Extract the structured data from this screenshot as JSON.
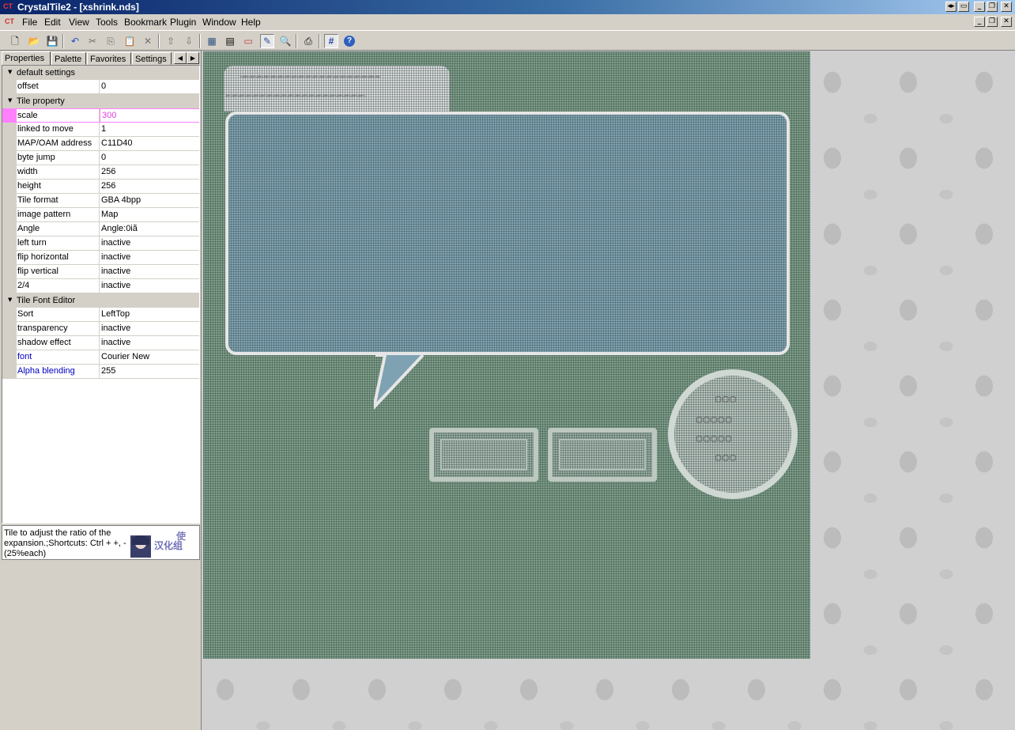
{
  "window": {
    "title": "CrystalTile2 - [xshrink.nds]",
    "app_icon": "crystaltile-logo-icon",
    "app_icon_text": "CT",
    "caption_buttons": [
      "restore-toggle-icon",
      "tile-icon",
      "minimize-icon",
      "maximize-icon",
      "close-icon"
    ],
    "caption_glyphs": [
      "◂▸",
      "▭",
      "_",
      "❐",
      "✕"
    ]
  },
  "menubar": {
    "logo_text": "CT",
    "items": [
      "File",
      "Edit",
      "View",
      "Tools",
      "Bookmark",
      "Plugin",
      "Window",
      "Help"
    ],
    "mdi_glyphs": [
      "_",
      "❐",
      "✕"
    ]
  },
  "toolbar": {
    "buttons": [
      {
        "name": "new-file-icon",
        "glyph": "🗋"
      },
      {
        "name": "open-folder-icon",
        "glyph": "📂"
      },
      {
        "name": "save-icon",
        "glyph": "💾"
      },
      {
        "name": "undo-icon",
        "glyph": "↶"
      },
      {
        "name": "cut-icon",
        "glyph": "✂"
      },
      {
        "name": "copy-icon",
        "glyph": "⎘"
      },
      {
        "name": "paste-icon",
        "glyph": "📋"
      },
      {
        "name": "delete-icon",
        "glyph": "✕"
      },
      {
        "name": "import-icon",
        "glyph": "⇧"
      },
      {
        "name": "export-icon",
        "glyph": "⇩"
      },
      {
        "name": "tile-viewer-icon",
        "glyph": "▦"
      },
      {
        "name": "hex-editor-icon",
        "glyph": "▤"
      },
      {
        "name": "text-icon",
        "glyph": "▭"
      },
      {
        "name": "edit-tile-icon",
        "glyph": "✎"
      },
      {
        "name": "search-icon",
        "glyph": "🔍"
      },
      {
        "name": "print-icon",
        "glyph": "⎙"
      },
      {
        "name": "grid-icon",
        "glyph": "#"
      },
      {
        "name": "help-icon",
        "glyph": "?"
      }
    ]
  },
  "panel": {
    "tabs": [
      "Properties",
      "Palette",
      "Favorites",
      "Settings"
    ],
    "tab_arrows": [
      "◀",
      "▶"
    ],
    "collapse_glyph": "▼",
    "categories": [
      {
        "label": "default settings",
        "rows": [
          {
            "name": "offset",
            "value": "0"
          }
        ]
      },
      {
        "label": "Tile property",
        "rows": [
          {
            "name": "scale",
            "value": "300"
          },
          {
            "name": "linked to move",
            "value": "1"
          },
          {
            "name": "MAP/OAM address",
            "value": "C11D40"
          },
          {
            "name": "byte jump",
            "value": "0"
          },
          {
            "name": "width",
            "value": "256"
          },
          {
            "name": "height",
            "value": "256"
          },
          {
            "name": "Tile format",
            "value": "GBA 4bpp"
          },
          {
            "name": "image pattern",
            "value": "Map"
          },
          {
            "name": "Angle",
            "value": "Angle:0iã"
          },
          {
            "name": "left turn",
            "value": "inactive"
          },
          {
            "name": "flip horizontal",
            "value": "inactive"
          },
          {
            "name": "flip vertical",
            "value": "inactive"
          },
          {
            "name": "2/4",
            "value": "inactive"
          }
        ]
      },
      {
        "label": "Tile Font Editor",
        "rows": [
          {
            "name": "Sort",
            "value": "LeftTop"
          },
          {
            "name": "transparency",
            "value": "inactive"
          },
          {
            "name": "shadow effect",
            "value": "inactive"
          },
          {
            "name": "font",
            "value": "Courier New"
          },
          {
            "name": "Alpha blending",
            "value": "255"
          }
        ]
      }
    ],
    "help_text": "Tile to adjust the ratio of the expansion.;Shortcuts: Ctrl + +, -(25%each)",
    "logo_text": "汉化组",
    "logo_text2": "使"
  },
  "colors": {
    "titlebar_start": "#0a246a",
    "titlebar_end": "#a6caf0",
    "selection_accent": "#ff80ff",
    "selected_value_text": "#e040e0",
    "link_text": "#0000c0",
    "tile_background": "#7f9c8a",
    "bubble_fill": "#7fa2b2"
  },
  "canvas": {
    "wavy_line_1": "~≈~≈~≈~≈~≈~≈~≈~≈~≈~≈~≈~≈~≈~≈~≈~≈~≈~≈~≈~≈",
    "wavy_line_2": "≈~≈~≈~≈~≈~≈~≈~≈~≈~≈~≈~≈~≈~≈~≈~≈~≈~≈~≈~≈~",
    "circle_rows": [
      "▢▢▢",
      "▢▢▢▢▢",
      "▢▢▢▢▢",
      "▢▢▢"
    ]
  }
}
